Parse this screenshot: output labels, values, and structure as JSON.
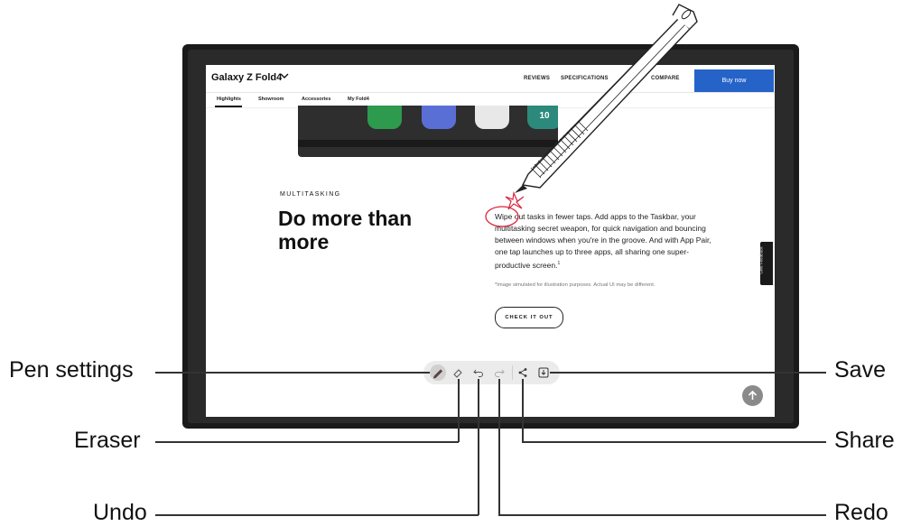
{
  "site": {
    "brand": "Galaxy Z Fold4",
    "nav_links": [
      "REVIEWS",
      "SPECIFICATIONS",
      "COMPARE"
    ],
    "buy_label": "Buy now",
    "sub_links": [
      "Highlights",
      "Showroom",
      "Accessories",
      "My Fold4"
    ]
  },
  "content": {
    "kicker": "MULTITASKING",
    "headline": "Do more than more",
    "paragraph": "Wipe out tasks in fewer taps. Add apps to the Taskbar, your multitasking secret weapon, for quick navigation and bouncing between windows when you're in the groove. And with App Pair, one tap launches up to three apps, all sharing one super-productive screen.",
    "footnote_mark": "1",
    "fine_print": "*Image simulated for illustration purposes. Actual UI may be different.",
    "cta": "CHECK IT OUT",
    "feedback": "Give Feedback"
  },
  "phone_preview": {
    "tile_colors": [
      "#2d9a4e",
      "#5a6fd6",
      "#e8e8e8",
      "#2c8a7c",
      "#c43a6a"
    ],
    "tile_numbers": [
      "",
      "",
      "",
      "10",
      ""
    ]
  },
  "toolbar": {
    "tools": [
      {
        "name": "pen-settings",
        "icon": "pen-icon"
      },
      {
        "name": "eraser",
        "icon": "eraser-icon"
      },
      {
        "name": "undo",
        "icon": "undo-icon"
      },
      {
        "name": "redo",
        "icon": "redo-icon"
      },
      {
        "name": "share",
        "icon": "share-icon"
      },
      {
        "name": "save",
        "icon": "save-icon"
      }
    ]
  },
  "callouts": {
    "pen_settings": "Pen settings",
    "eraser": "Eraser",
    "undo": "Undo",
    "save": "Save",
    "share": "Share",
    "redo": "Redo"
  },
  "colors": {
    "accent": "#2563c9",
    "annotation": "#d7263d"
  }
}
